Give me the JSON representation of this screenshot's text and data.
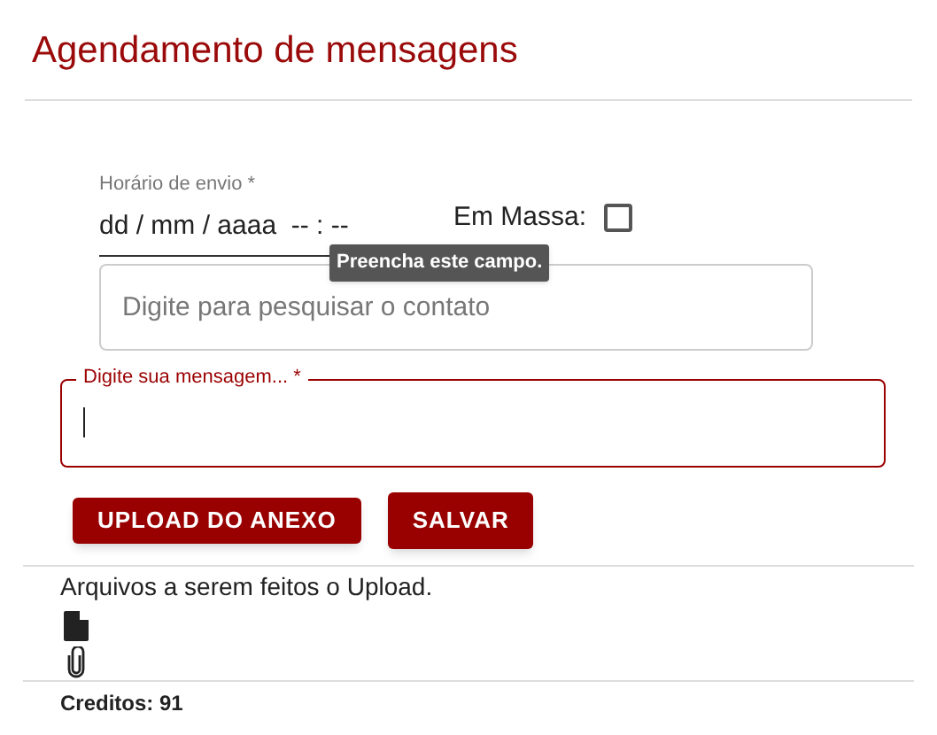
{
  "title": "Agendamento de mensagens",
  "schedule_field": {
    "label": "Horário de envio *",
    "value": "dd / mm / aaaa  -- : --"
  },
  "tooltip": "Preencha este campo.",
  "bulk": {
    "label": "Em Massa:",
    "checked": false
  },
  "contact_search": {
    "placeholder": "Digite para pesquisar o contato"
  },
  "message_field": {
    "label": "Digite sua mensagem... *"
  },
  "buttons": [
    "UPLOAD DO ANEXO",
    "SALVAR"
  ],
  "attachments_text": "Arquivos a serem feitos o Upload.",
  "credits": "Creditos: 91"
}
